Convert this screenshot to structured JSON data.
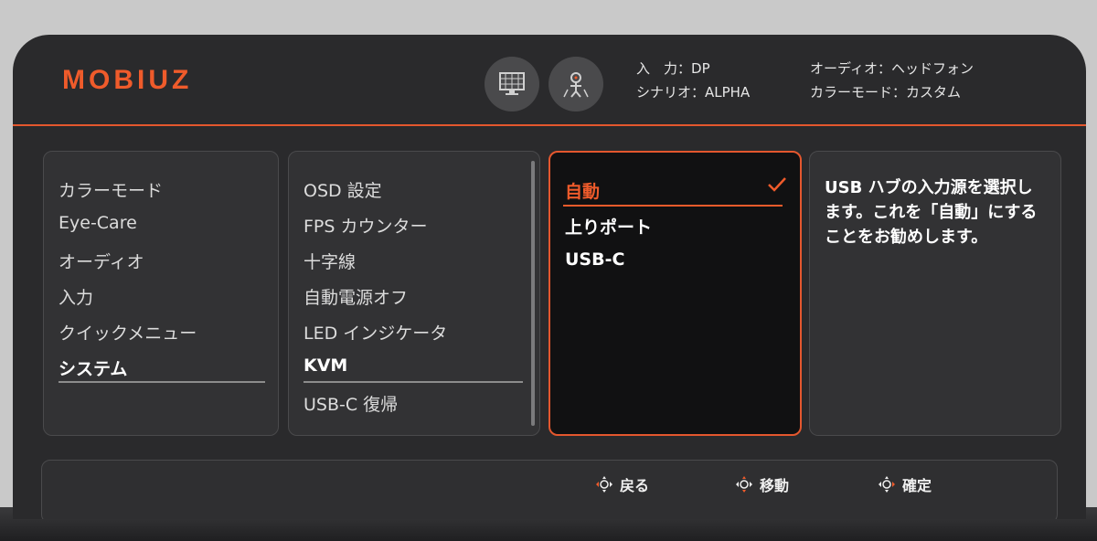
{
  "header": {
    "logo": "MOBIUZ",
    "mode_icons": [
      "monitor-grid-icon",
      "game-character-icon"
    ],
    "status": {
      "input_label": "入　力：",
      "input_value": "DP",
      "scenario_label": "シナリオ：",
      "scenario_value": "ALPHA",
      "audio_label": "オーディオ：",
      "audio_value": "ヘッドフォン",
      "color_mode_label": "カラーモード：",
      "color_mode_value": "カスタム"
    }
  },
  "main_menu": {
    "items": [
      "カラーモード",
      "Eye-Care",
      "オーディオ",
      "入力",
      "クイックメニュー",
      "システム"
    ],
    "active_index": 5
  },
  "system_menu": {
    "items": [
      "OSD 設定",
      "FPS カウンター",
      "十字線",
      "自動電源オフ",
      "LED インジケータ",
      "KVM",
      "USB-C 復帰"
    ],
    "active_index": 5
  },
  "kvm_options": {
    "items": [
      "自動",
      "上りポート",
      "USB-C"
    ],
    "selected_index": 0
  },
  "help_text": "USB ハブの入力源を選択します。これを「自動」にすることをお勧めします。",
  "footer": {
    "back": "戻る",
    "move": "移動",
    "confirm": "確定"
  },
  "colors": {
    "accent": "#ef5b2b",
    "panel_bg": "#323234",
    "osd_bg": "#2a2a2c"
  }
}
